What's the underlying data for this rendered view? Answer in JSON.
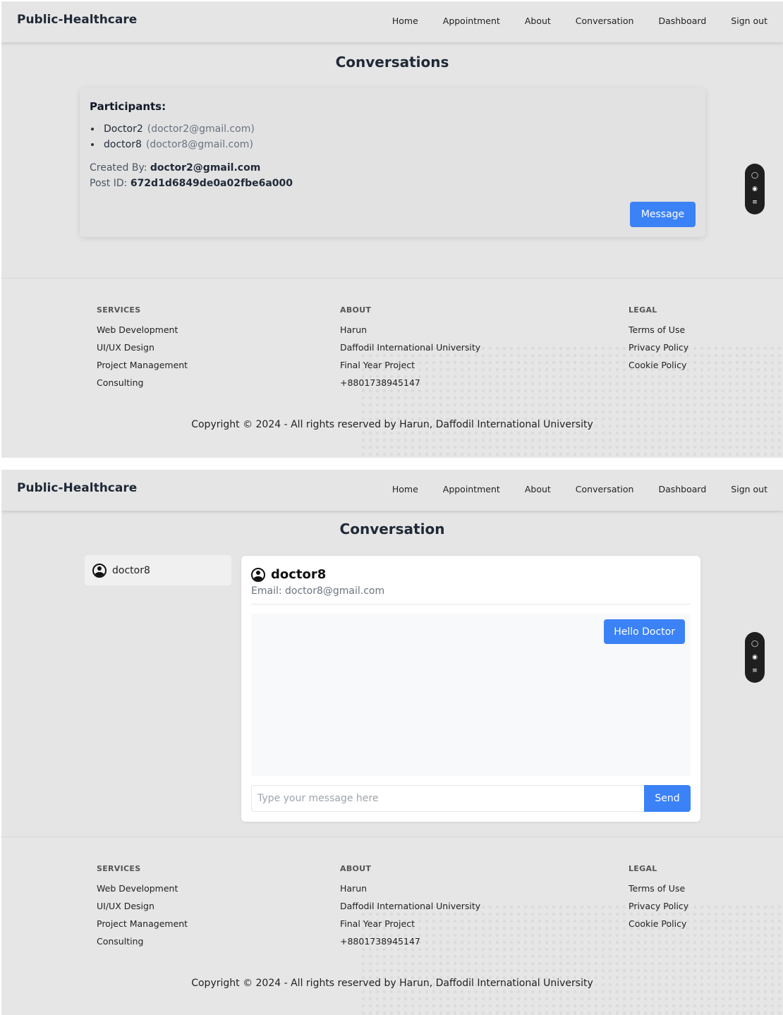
{
  "brand": "Public-Healthcare",
  "nav": [
    "Home",
    "Appointment",
    "About",
    "Conversation",
    "Dashboard",
    "Sign out"
  ],
  "conversations_page": {
    "title": "Conversations",
    "participants_heading": "Participants:",
    "participants": [
      {
        "name": "Doctor2",
        "email": "(doctor2@gmail.com)"
      },
      {
        "name": "doctor8",
        "email": "(doctor8@gmail.com)"
      }
    ],
    "created_by_label": "Created By:",
    "created_by_value": "doctor2@gmail.com",
    "post_id_label": "Post ID:",
    "post_id_value": "672d1d6849de0a02fbe6a000",
    "message_button": "Message"
  },
  "conversation_page": {
    "title": "Conversation",
    "sidebar_user": "doctor8",
    "chat_name": "doctor8",
    "chat_email": "Email: doctor8@gmail.com",
    "messages": [
      "Hello Doctor"
    ],
    "input_placeholder": "Type your message here",
    "send_button": "Send"
  },
  "footer": {
    "services": {
      "title": "SERVICES",
      "links": [
        "Web Development",
        "UI/UX Design",
        "Project Management",
        "Consulting"
      ]
    },
    "about": {
      "title": "ABOUT",
      "links": [
        "Harun",
        "Daffodil International University",
        "Final Year Project",
        "+8801738945147"
      ]
    },
    "legal": {
      "title": "LEGAL",
      "links": [
        "Terms of Use",
        "Privacy Policy",
        "Cookie Policy"
      ]
    },
    "copyright": "Copyright © 2024 - All rights reserved by Harun, Daffodil International University"
  },
  "toolbar_icons": [
    "chat-bubble-icon",
    "eye-icon",
    "list-icon"
  ]
}
